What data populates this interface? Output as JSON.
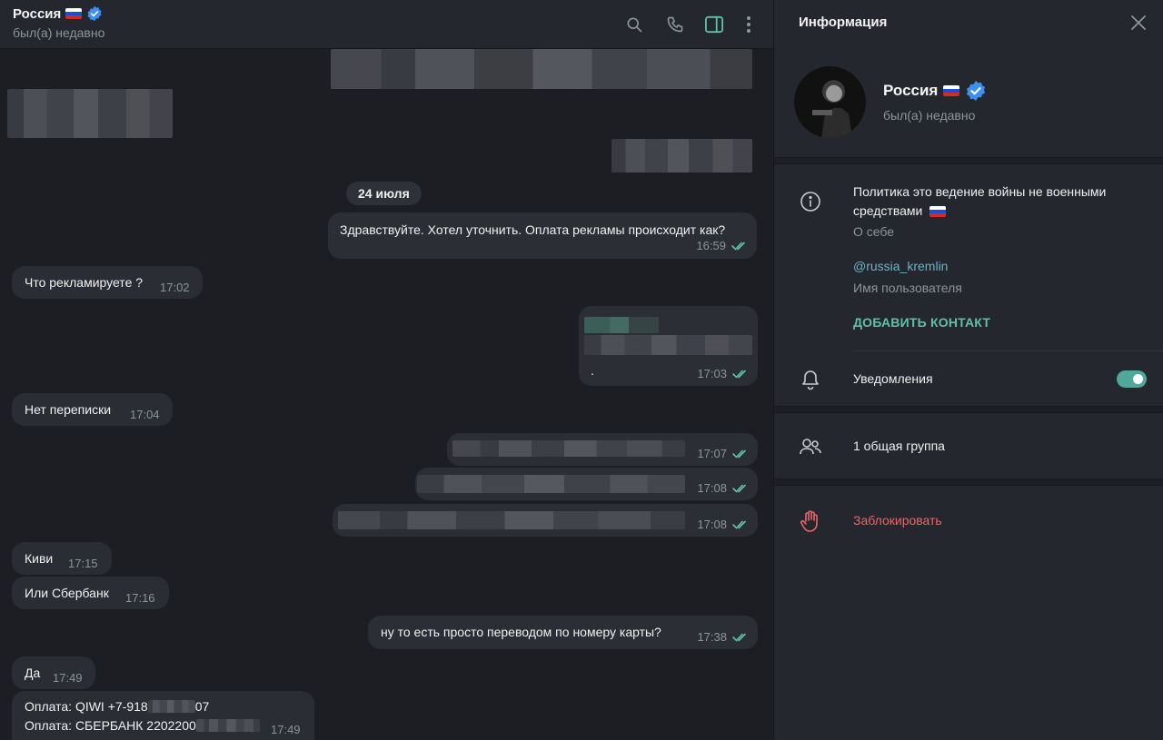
{
  "header": {
    "title": "Россия",
    "status": "был(а) недавно"
  },
  "chat": {
    "date_separator": "24 июля",
    "messages": [
      {
        "dir": "out",
        "text": "Здравствуйте. Хотел уточнить. Оплата рекламы происходит как?",
        "time": "16:59"
      },
      {
        "dir": "in",
        "text": "Что рекламируете ?",
        "time": "17:02"
      },
      {
        "dir": "out",
        "text": ".",
        "time": "17:03"
      },
      {
        "dir": "in",
        "text": "Нет переписки",
        "time": "17:04"
      },
      {
        "dir": "out",
        "text": "",
        "time": "17:07"
      },
      {
        "dir": "out",
        "text": "",
        "time": "17:08"
      },
      {
        "dir": "out",
        "text": "",
        "time": "17:08"
      },
      {
        "dir": "in",
        "text": "Киви",
        "time": "17:15"
      },
      {
        "dir": "in",
        "text": "Или Сбербанк",
        "time": "17:16"
      },
      {
        "dir": "out",
        "text": "ну то есть просто переводом по номеру карты?",
        "time": "17:38"
      },
      {
        "dir": "in",
        "text": "Да",
        "time": "17:49"
      },
      {
        "dir": "in",
        "line1_prefix": "Оплата: QIWI +7-918",
        "line1_suffix": "07",
        "line2_prefix": "Оплата: СБЕРБАНК 2202200",
        "time": "17:49"
      }
    ]
  },
  "info": {
    "title": "Информация",
    "name": "Россия",
    "status": "был(а) недавно",
    "bio": "Политика это ведение войны не военными средствами",
    "bio_label": "О себе",
    "username": "@russia_kremlin",
    "username_label": "Имя пользователя",
    "add_contact": "ДОБАВИТЬ КОНТАКТ",
    "notifications": "Уведомления",
    "notifications_on": true,
    "groups": "1 общая группа",
    "block": "Заблокировать"
  },
  "colors": {
    "accent": "#5fc1ab",
    "link": "#6ab3c8",
    "danger": "#e8676a",
    "verified": "#3d8ff0"
  },
  "icons": [
    "search-icon",
    "phone-icon",
    "sidebar-toggle-icon",
    "more-vert-icon",
    "close-icon",
    "info-icon",
    "bell-icon",
    "group-icon",
    "hand-stop-icon",
    "double-check-icon",
    "verified-badge-icon",
    "russian-flag-icon"
  ]
}
